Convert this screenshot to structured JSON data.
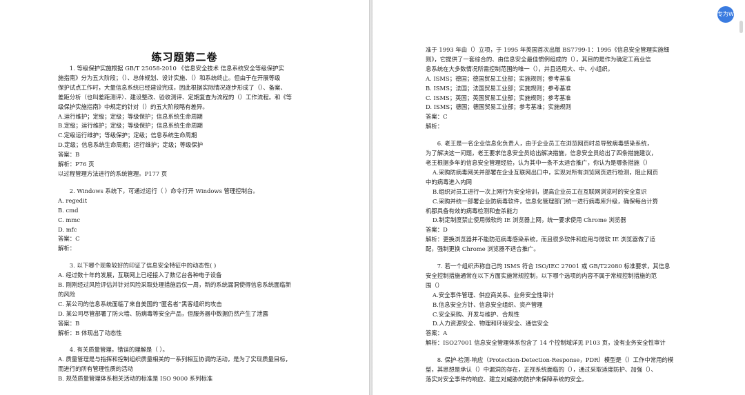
{
  "badge": "专为W",
  "left": {
    "title": "练习题第二卷",
    "lines": [
      {
        "t": "1. 等级保护实施根据 GB/T  25058-2010 《信息安全技术 信息系统安全等级保护实",
        "c": "q"
      },
      {
        "t": "施指南》分为五大阶段；（）、总体规划、设计实施、（）和系统终止。但由于在开展等级",
        "c": ""
      },
      {
        "t": "保护试点工作时，大量信息系统已经建设完成，因此根据实际情况逐步形成了（）、备案、",
        "c": ""
      },
      {
        "t": "差距分析（也叫差距测评）、建设整改、验收测评、定期复查为流程的（）工作流程。和《等",
        "c": ""
      },
      {
        "t": "级保护实施指南》中规定的针对（）的五大阶段略有差异。",
        "c": ""
      },
      {
        "t": "A.运行维护；定级；定级；等级保护；信息系统生命周期",
        "c": ""
      },
      {
        "t": "B.定级；运行维护；定级；等级保护；信息系统生命周期",
        "c": ""
      },
      {
        "t": "C.定级运行维护；等级保护；定级；信息系统生命周期",
        "c": ""
      },
      {
        "t": "D.定级；信息系统生命周期；运行维护；定级；等级保护",
        "c": ""
      },
      {
        "t": "答案：B",
        "c": ""
      },
      {
        "t": "解析：P76 页",
        "c": ""
      },
      {
        "t": "以过程管理方法进行的系统管理。P177 页",
        "c": ""
      },
      {
        "t": "",
        "c": "gap"
      },
      {
        "t": "2. Windows 系统下，可通过运行（  ）命令打开 Windows 管理控制台。",
        "c": "q"
      },
      {
        "t": "A. regedit",
        "c": ""
      },
      {
        "t": "B. cmd",
        "c": ""
      },
      {
        "t": "C. mmc",
        "c": ""
      },
      {
        "t": "D. mfc",
        "c": ""
      },
      {
        "t": "答案：C",
        "c": ""
      },
      {
        "t": "解析：",
        "c": ""
      },
      {
        "t": "",
        "c": "gap"
      },
      {
        "t": "3. 以下哪个现象较好的印证了信息安全特征中的动态性( )",
        "c": "q"
      },
      {
        "t": "A. 经过数十年的发展，互联网上已经接入了数亿台各种电子设备",
        "c": ""
      },
      {
        "t": "B. 刚刚经过风险评估并针对风险采取处理措施后仅一周，新的系统漏洞使得信息系统面临新",
        "c": ""
      },
      {
        "t": "的风险",
        "c": ""
      },
      {
        "t": "C. 某公司的信息系统面临了来自美国的“匿名者”黑客组织的攻击",
        "c": ""
      },
      {
        "t": "D. 某公司尽管部署了防火墙、防病毒等安全产品，但服务器中数据仍然产生了泄露",
        "c": ""
      },
      {
        "t": "答案：B",
        "c": ""
      },
      {
        "t": "解析：B 体现出了动态性",
        "c": ""
      },
      {
        "t": "",
        "c": "gap"
      },
      {
        "t": "4. 有关质量管理，错误的理解是（  ）。",
        "c": "q"
      },
      {
        "t": "A. 质量管理是与指挥和控制组织质量相关的一系列相互协调的活动，是为了实现质量目标，",
        "c": ""
      },
      {
        "t": "而进行的所有管理性质的活动",
        "c": ""
      },
      {
        "t": "B. 规范质量管理体系相关活动的标准是 ISO 9000 系列标准",
        "c": ""
      }
    ]
  },
  "right": {
    "lines": [
      {
        "t": "准于 1993 年由（）立项，于 1995 年英国首次出版 BS7799-1：1995《信息安全管理实施细",
        "c": ""
      },
      {
        "t": "则》，它提供了一套综合的、由信息安全最佳惯例组成的（），其目的是作为确定工商业信",
        "c": ""
      },
      {
        "t": "息系统在大多数情况所需控制范围的唯一（），并且适用大、中、小组织。",
        "c": ""
      },
      {
        "t": "A. ISMS；德国；德国贸易工业部；实施规则；参考基准",
        "c": ""
      },
      {
        "t": "B. ISMS；法国；法国贸易工业部；实施规则；参考基准",
        "c": ""
      },
      {
        "t": "C. ISMS；英国；英国贸易工业部；实施规则；参考基准",
        "c": ""
      },
      {
        "t": "D. ISMS；德国；德国贸易工业部；参考基准；实施规则",
        "c": ""
      },
      {
        "t": "答案：C",
        "c": ""
      },
      {
        "t": "解析：",
        "c": ""
      },
      {
        "t": "",
        "c": "gap"
      },
      {
        "t": "6. 老王是一名企业信息化负责人，由于企业员工在浏览网页时总导致病毒感染系统，",
        "c": "q"
      },
      {
        "t": "为了解决这一问题，老王要求信息安全员给出解决措施，信息安全员给出了四条措施建议，",
        "c": ""
      },
      {
        "t": "老王根据多年的信息安全管理经验，认为其中一条不太适合推广，你认为是哪条措施（）",
        "c": ""
      },
      {
        "t": "A.采购防病毒网关并部署在企业互联网出口中，实现对所有浏览网页进行检测，阻止网页",
        "c": "ind"
      },
      {
        "t": "中的病毒进入内网",
        "c": ""
      },
      {
        "t": "B.组织对员工进行一次上网行为安全培训，提高企业员工在互联网浏览时的安全意识",
        "c": "ind"
      },
      {
        "t": "C.采购并统一部署企业防病毒软件，信息化管理部门统一进行病毒库升级，确保每台计算",
        "c": "ind"
      },
      {
        "t": "机都具备有效的病毒检测和查杀能力",
        "c": ""
      },
      {
        "t": "D.制定制度禁止使用微软的 IE 浏览器上网，统一要求使用 Chrome 浏览器",
        "c": "ind"
      },
      {
        "t": "答案：D",
        "c": ""
      },
      {
        "t": "解析：更换浏览器并不能防范病毒感染系统，而且很多软件和应用与微软 IE 浏览器做了适",
        "c": ""
      },
      {
        "t": "配，强制更换 Chrome 浏览器不适合推广。",
        "c": ""
      },
      {
        "t": "",
        "c": "gap"
      },
      {
        "t": "7. 若一个组织声称自己的 ISMS 符合 ISO/IEC 27001 或 GB/T22080 标准要求，其信息",
        "c": "q"
      },
      {
        "t": "安全控制措施通常在以下方面实施常规控制，以下哪个选项的内容不属于常规控制措施的范",
        "c": ""
      },
      {
        "t": "围（）",
        "c": ""
      },
      {
        "t": "A.安全事件管理、供应商关系、业务安全性审计",
        "c": "ind"
      },
      {
        "t": "B.信息安全方针、信息安全组织、资产管理",
        "c": "ind"
      },
      {
        "t": "C.安全采购、开发与维护、合规性",
        "c": "ind"
      },
      {
        "t": "D.人力资源安全、物理和环境安全、通信安全",
        "c": "ind"
      },
      {
        "t": "答案：A",
        "c": ""
      },
      {
        "t": "解析：ISO27001 信息安全管理体系包含了 14 个控制域详见 P103 页，没有业务安全性审计",
        "c": ""
      },
      {
        "t": "",
        "c": "gap"
      },
      {
        "t": "8. 保护-检测-响应（Protection-Detection-Response，PDR）模型是（）工作中常用的模",
        "c": "q"
      },
      {
        "t": "型，其思想是承认（）中漏洞的存在，正视系统面临的（），通过采取适度防护、加强（）、",
        "c": ""
      },
      {
        "t": "落实对安全事件的响应、建立对威胁的防护来保障系统的安全。",
        "c": ""
      }
    ]
  }
}
